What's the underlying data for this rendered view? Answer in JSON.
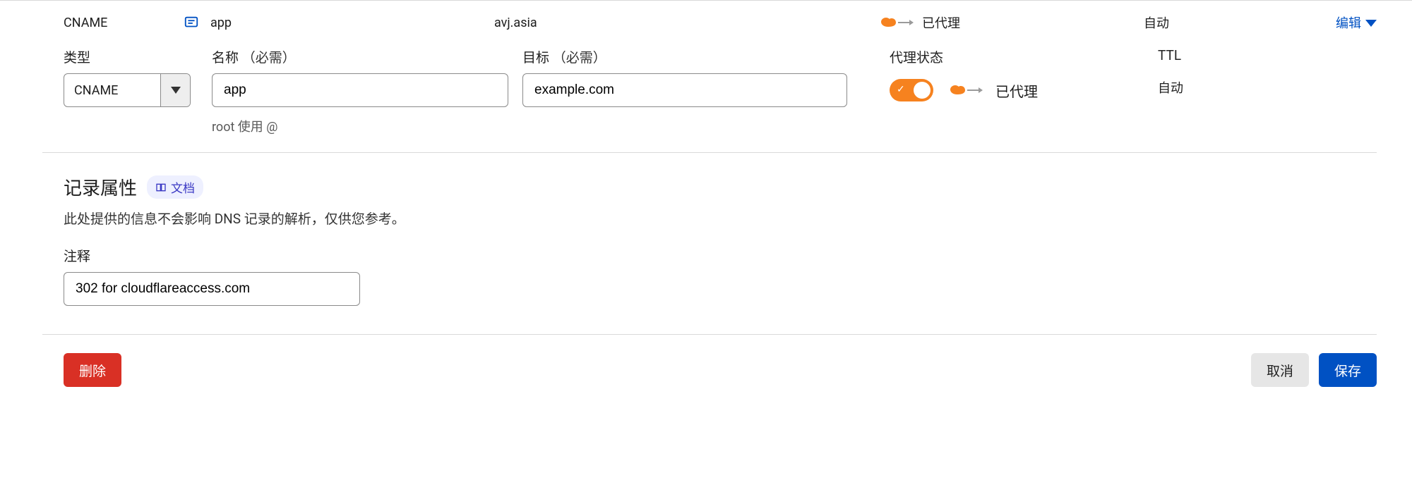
{
  "summary": {
    "type": "CNAME",
    "name": "app",
    "target": "avj.asia",
    "proxy_status": "已代理",
    "ttl": "自动",
    "edit": "编辑"
  },
  "labels": {
    "type": "类型",
    "name": "名称",
    "target": "目标",
    "required": "（必需）",
    "proxy_state": "代理状态",
    "ttl": "TTL",
    "name_hint": "root 使用 @"
  },
  "form": {
    "type_value": "CNAME",
    "name_value": "app",
    "target_value": "example.com",
    "proxy_text": "已代理",
    "ttl_value": "自动"
  },
  "attrs": {
    "title": "记录属性",
    "doc_link": "文档",
    "desc": "此处提供的信息不会影响 DNS 记录的解析，仅供您参考。",
    "comment_label": "注释",
    "comment_value": "302 for cloudflareaccess.com"
  },
  "buttons": {
    "delete": "删除",
    "cancel": "取消",
    "save": "保存"
  }
}
